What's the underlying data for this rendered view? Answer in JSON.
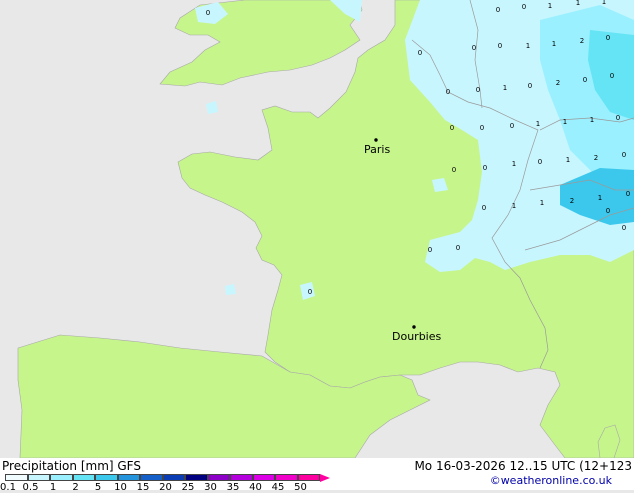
{
  "header": {
    "legend_title": "Precipitation [mm]  GFS",
    "forecast_time": "Mo 16-03-2026 12..15 UTC (12+123",
    "credit": "©weatheronline.co.uk"
  },
  "cities": [
    {
      "name": "Paris"
    },
    {
      "name": "Dourbies"
    }
  ],
  "legend_scale": {
    "labels": [
      "0.1",
      "0.5",
      "1",
      "2",
      "5",
      "10",
      "15",
      "20",
      "25",
      "30",
      "35",
      "40",
      "45",
      "50"
    ],
    "colors": [
      "#f0fcff",
      "#c8f6ff",
      "#9af0ff",
      "#64e4f4",
      "#3cc8ec",
      "#2494dc",
      "#1460c8",
      "#0a3cb4",
      "#000080",
      "#8c00c8",
      "#b400dc",
      "#dc00e6",
      "#f000c8",
      "#ff00a0"
    ]
  },
  "precip_values": [
    "0",
    "0",
    "0",
    "1",
    "1",
    "1",
    "0",
    "0",
    "0",
    "1",
    "1",
    "2",
    "0",
    "0",
    "0",
    "1",
    "0",
    "2",
    "0",
    "0",
    "0",
    "0",
    "0",
    "1",
    "1",
    "1",
    "0",
    "0",
    "0",
    "1",
    "0",
    "1",
    "2",
    "0",
    "0",
    "1",
    "1",
    "2",
    "1",
    "0",
    "0",
    "0",
    "0",
    "0",
    "0"
  ],
  "colors": {
    "land": "#c6f58c",
    "sea": "#e8e8e8",
    "precip_light": "#c8f6ff",
    "precip_mid": "#9af0ff",
    "precip_high": "#64e4f4",
    "precip_heavy": "#3cc8ec",
    "credit": "#0000aa"
  }
}
